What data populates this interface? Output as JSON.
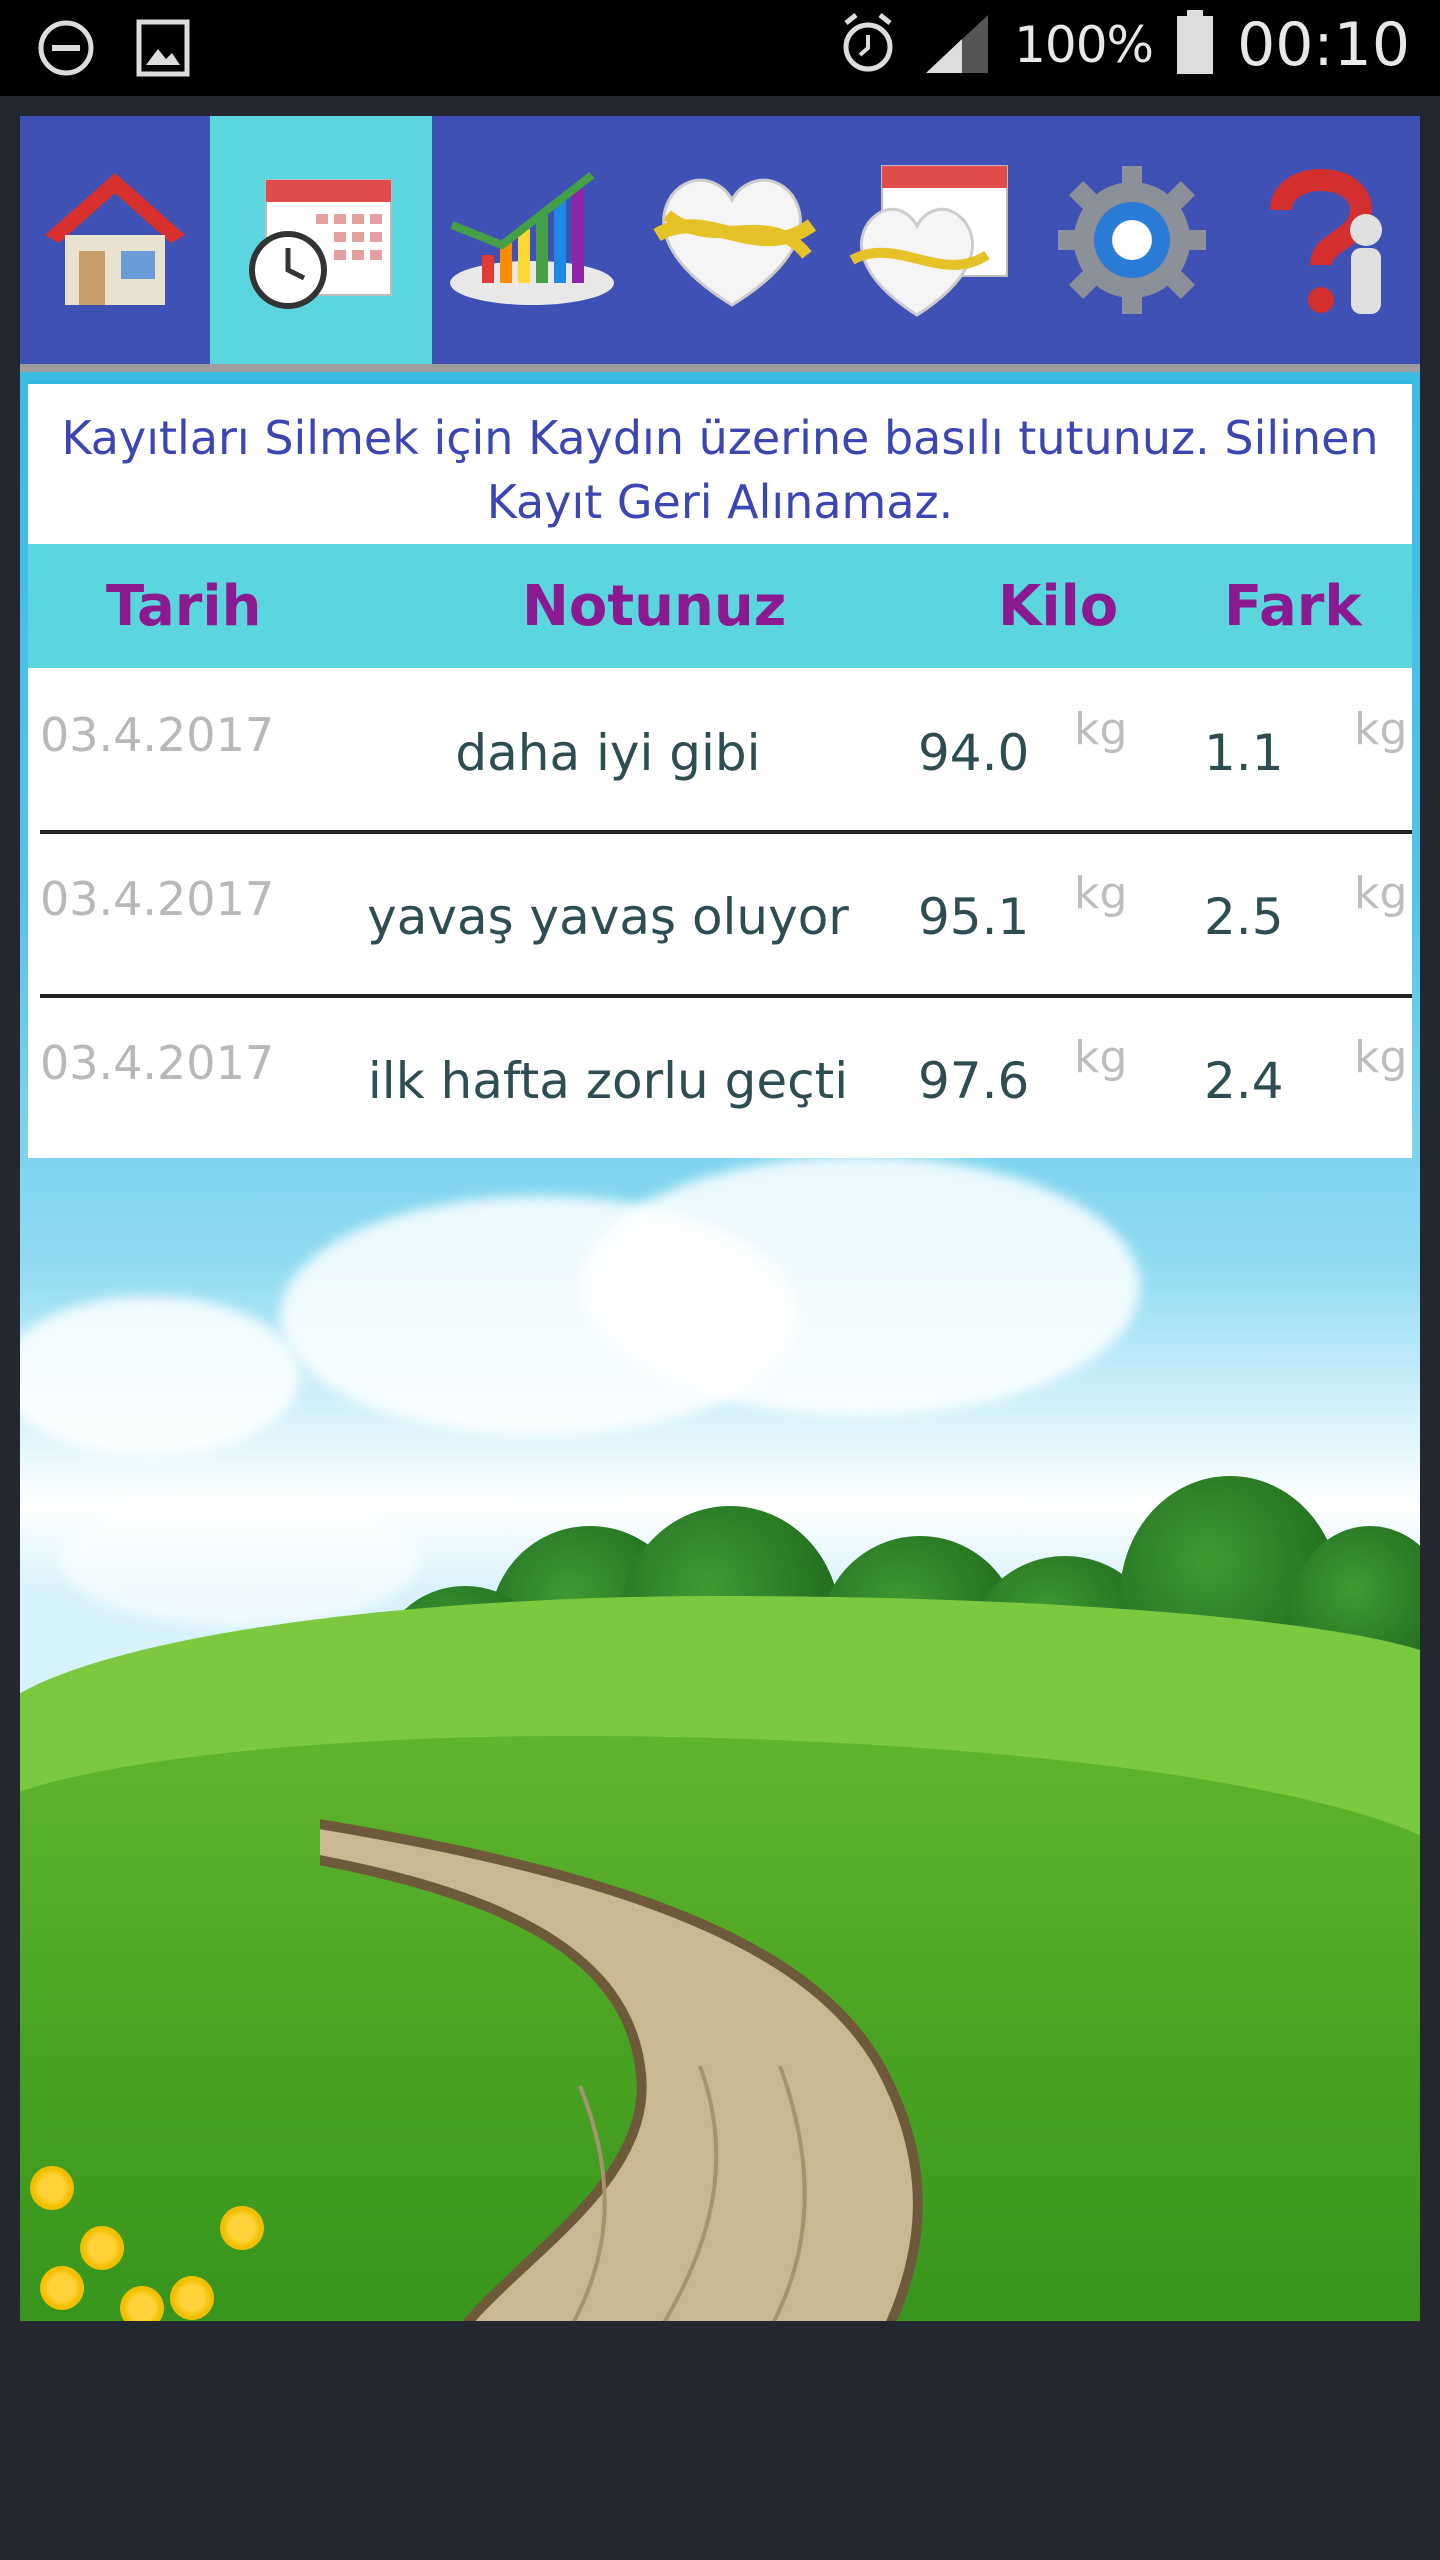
{
  "status_bar": {
    "left_icons": [
      "do-not-disturb-icon",
      "gallery-icon"
    ],
    "right_icons": [
      "alarm-icon",
      "signal-icon",
      "battery-icon"
    ],
    "battery_percent": "100%",
    "time": "00:10"
  },
  "toolbar": {
    "items": [
      {
        "name": "home",
        "icon": "house-icon",
        "active": false
      },
      {
        "name": "history",
        "icon": "calendar-clock-icon",
        "active": true
      },
      {
        "name": "chart",
        "icon": "bar-chart-icon",
        "active": false
      },
      {
        "name": "measure",
        "icon": "heart-tape-icon",
        "active": false
      },
      {
        "name": "measure-calendar",
        "icon": "heart-calendar-icon",
        "active": false
      },
      {
        "name": "settings",
        "icon": "gear-icon",
        "active": false
      },
      {
        "name": "help",
        "icon": "question-icon",
        "active": false
      }
    ]
  },
  "info_text": "Kayıtları Silmek için Kaydın üzerine basılı tutunuz. Silinen Kayıt Geri Alınamaz.",
  "table": {
    "headers": {
      "date": "Tarih",
      "note": "Notunuz",
      "kilo": "Kilo",
      "fark": "Fark"
    },
    "rows": [
      {
        "date": "03.4.2017",
        "note": "daha iyi gibi",
        "kilo": "94.0",
        "kilo_unit": "kg",
        "fark": "1.1",
        "fark_unit": "kg"
      },
      {
        "date": "03.4.2017",
        "note": "yavaş yavaş oluyor",
        "kilo": "95.1",
        "kilo_unit": "kg",
        "fark": "2.5",
        "fark_unit": "kg"
      },
      {
        "date": "03.4.2017",
        "note": "ilk hafta zorlu geçti",
        "kilo": "97.6",
        "kilo_unit": "kg",
        "fark": "2.4",
        "fark_unit": "kg"
      }
    ]
  },
  "colors": {
    "toolbar": "#3f51b5",
    "active_tab": "#5bd6df",
    "header_text": "#8b1a91",
    "info_text": "#3c46b3"
  }
}
